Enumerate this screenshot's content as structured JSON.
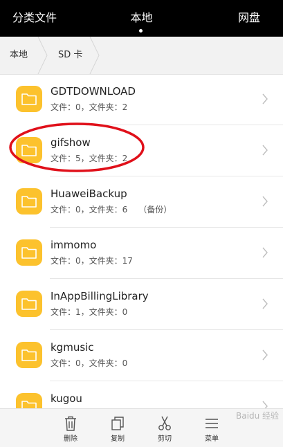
{
  "tabs": {
    "left": "分类文件",
    "center": "本地",
    "right": "网盘"
  },
  "breadcrumb": {
    "local": "本地",
    "sd": "SD 卡"
  },
  "folders": [
    {
      "name": "GDTDOWNLOAD",
      "meta": "文件：0，文件夹：2",
      "tag": ""
    },
    {
      "name": "gifshow",
      "meta": "文件：5，文件夹：2",
      "tag": ""
    },
    {
      "name": "HuaweiBackup",
      "meta": "文件：0，文件夹：6",
      "tag": "（备份）"
    },
    {
      "name": "immomo",
      "meta": "文件：0，文件夹：17",
      "tag": ""
    },
    {
      "name": "InAppBillingLibrary",
      "meta": "文件：1，文件夹：0",
      "tag": ""
    },
    {
      "name": "kgmusic",
      "meta": "文件：0，文件夹：0",
      "tag": ""
    },
    {
      "name": "kugou",
      "meta": "",
      "tag": ""
    }
  ],
  "toolbar": {
    "delete": "删除",
    "copy": "复制",
    "cut": "剪切",
    "menu": "菜单"
  },
  "watermark": "Baidu 经验",
  "colors": {
    "folder": "#fcc22d",
    "highlight": "#e0101a",
    "topbar": "#000000"
  }
}
